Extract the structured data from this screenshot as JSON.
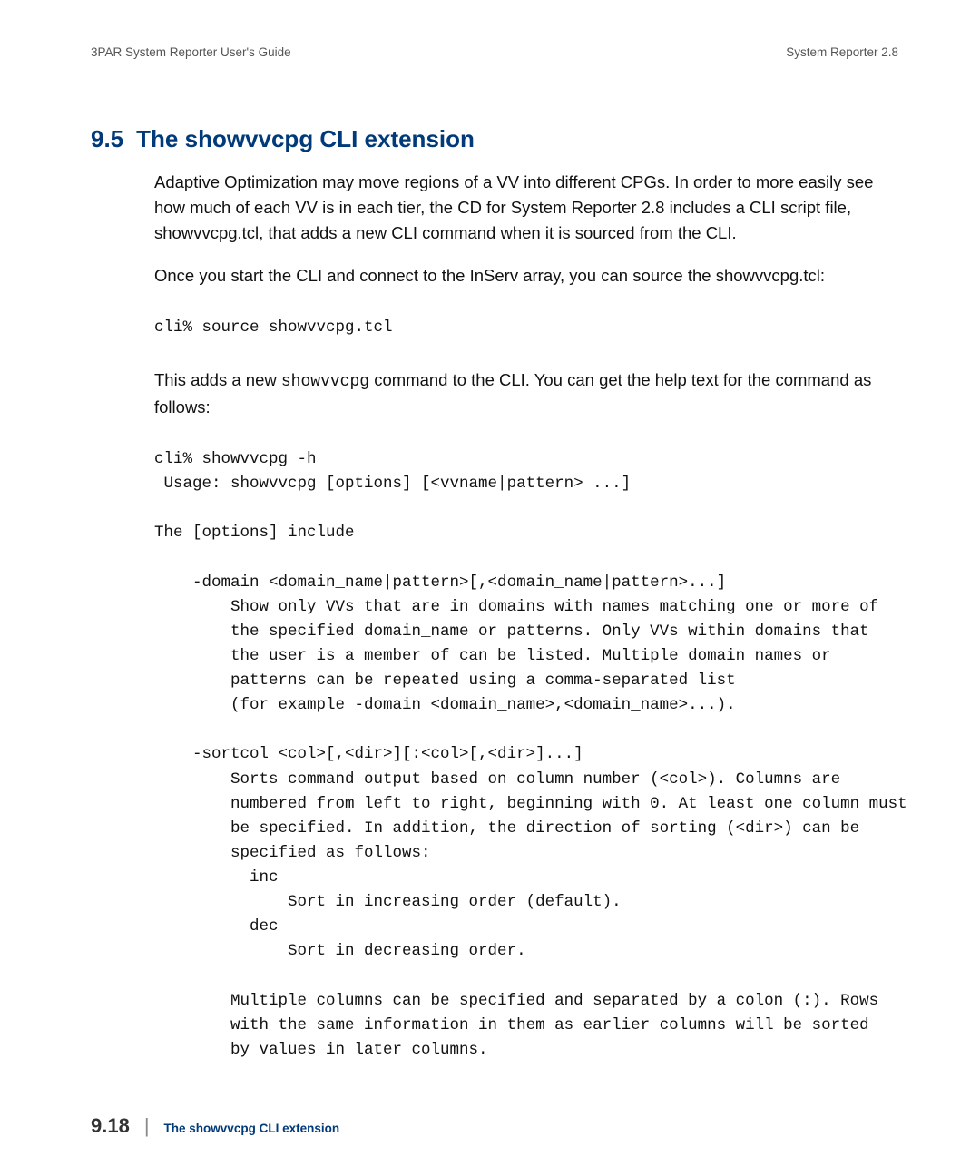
{
  "header": {
    "left": "3PAR System Reporter User's Guide",
    "right": "System Reporter 2.8"
  },
  "section": {
    "number": "9.5",
    "title": "The showvvcpg CLI extension"
  },
  "paras": {
    "p1": "Adaptive Optimization may move regions of a VV into different CPGs. In order to more easily see how much of each VV is in each tier, the CD for System Reporter 2.8 includes a CLI script file, showvvcpg.tcl, that adds a new CLI command when it is sourced from the CLI.",
    "p2": "Once you start the CLI and connect to the InServ array, you can source the showvvcpg.tcl:",
    "p3a": "This adds a new ",
    "p3b": "showvvcpg",
    "p3c": " command to the CLI. You can get the help text for the command as follows:"
  },
  "code1": "cli% source showvvcpg.tcl",
  "code2": "cli% showvvcpg -h\n Usage: showvvcpg [options] [<vvname|pattern> ...]\n\nThe [options] include\n\n    -domain <domain_name|pattern>[,<domain_name|pattern>...]\n        Show only VVs that are in domains with names matching one or more of\n        the specified domain_name or patterns. Only VVs within domains that\n        the user is a member of can be listed. Multiple domain names or\n        patterns can be repeated using a comma-separated list\n        (for example -domain <domain_name>,<domain_name>...).\n\n    -sortcol <col>[,<dir>][:<col>[,<dir>]...]\n        Sorts command output based on column number (<col>). Columns are\n        numbered from left to right, beginning with 0. At least one column must\n        be specified. In addition, the direction of sorting (<dir>) can be\n        specified as follows:\n          inc\n              Sort in increasing order (default).\n          dec\n              Sort in decreasing order.\n\n        Multiple columns can be specified and separated by a colon (:). Rows\n        with the same information in them as earlier columns will be sorted\n        by values in later columns.",
  "footer": {
    "page": "9.18",
    "sep": "|",
    "title": "The showvvcpg CLI extension"
  }
}
